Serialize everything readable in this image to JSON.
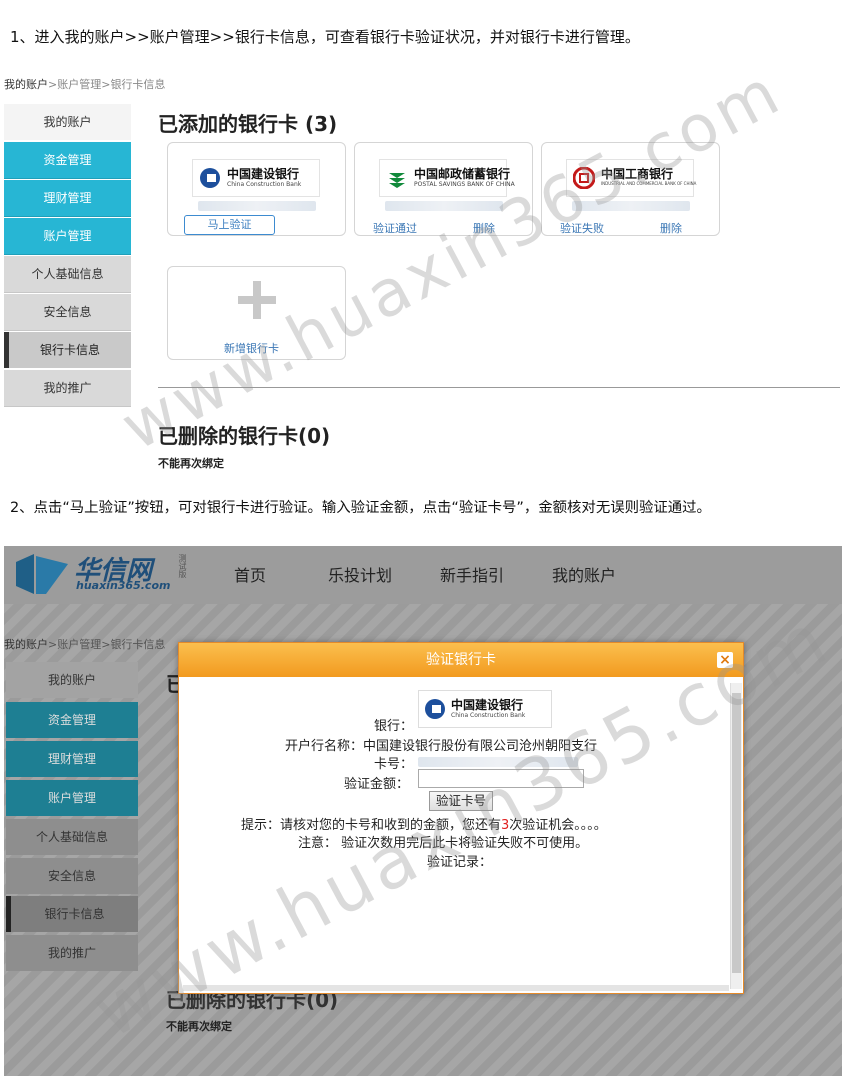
{
  "step1": "1、进入我的账户>>账户管理>>银行卡信息，可查看银行卡验证状况，并对银行卡进行管理。",
  "step2": "2、点击“马上验证”按钮，可对银行卡进行验证。输入验证金额，点击“验证卡号”，金额核对无误则验证通过。",
  "breadcrumb": {
    "root": "我的账户",
    "sep": ">",
    "mid": "账户管理",
    "cur": "银行卡信息"
  },
  "sidebar": {
    "items": [
      {
        "label": "我的账户"
      },
      {
        "label": "资金管理"
      },
      {
        "label": "理财管理"
      },
      {
        "label": "账户管理"
      },
      {
        "label": "个人基础信息"
      },
      {
        "label": "安全信息"
      },
      {
        "label": "银行卡信息"
      },
      {
        "label": "我的推广"
      }
    ]
  },
  "added": {
    "title": "已添加的银行卡 (3)",
    "cards": [
      {
        "bank": "中国建设银行",
        "bank_en": "China Construction Bank",
        "action": "马上验证"
      },
      {
        "bank": "中国邮政储蓄银行",
        "bank_en": "POSTAL SAVINGS BANK OF CHINA",
        "status": "验证通过",
        "delete": "删除"
      },
      {
        "bank": "中国工商银行",
        "bank_en": "INDUSTRIAL AND COMMERCIAL BANK OF CHINA",
        "status": "验证失败",
        "delete": "删除"
      }
    ],
    "add_card": "新增银行卡"
  },
  "deleted": {
    "title": "已删除的银行卡(0)",
    "note": "不能再次绑定"
  },
  "site": {
    "logo": "华信网",
    "logo_sub": "huaxin365.com",
    "logo_badge": "测试版",
    "nav": [
      "首页",
      "乐投计划",
      "新手指引",
      "我的账户"
    ]
  },
  "bg_page": {
    "title_partial": "已",
    "deleted_title": "已删除的银行卡(0)",
    "deleted_note": "不能再次绑定"
  },
  "dialog": {
    "title": "验证银行卡",
    "close": "×",
    "bank_label": "银行：",
    "bank_name": "中国建设银行",
    "bank_en": "China Construction Bank",
    "branch_label": "开户行名称：",
    "branch_value": "中国建设银行股份有限公司沧州朝阳支行",
    "card_label": "卡号：",
    "amount_label": "验证金额：",
    "amount_value": "",
    "verify_button": "验证卡号",
    "hint_prefix": "提示：请核对您的卡号和收到的金额，您还有",
    "hint_count": "3",
    "hint_suffix": "次验证机会。。。。",
    "notice": "注意： 验证次数用完后此卡将验证失败不可使用。",
    "records_label": "验证记录："
  },
  "watermark": "www.huaxin365.com",
  "colors": {
    "sidebar_blue": "#27b6d4",
    "dialog_orange": "#f29a1f",
    "link_blue": "#3b77b5",
    "count_red": "#e02020"
  }
}
